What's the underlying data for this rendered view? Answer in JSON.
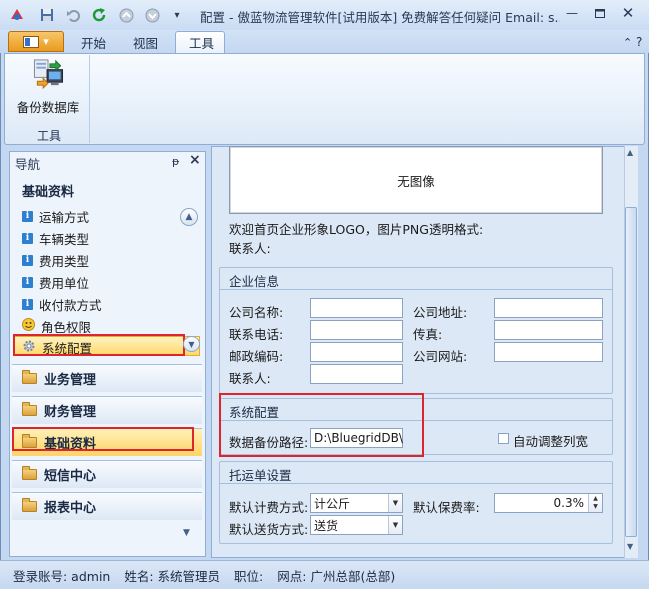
{
  "window": {
    "title": "配置 - 傲蓝物流管理软件[试用版本] 免费解答任何疑问 Email: s..."
  },
  "quick_access": {
    "icons": [
      "save-icon",
      "undo-icon",
      "refresh-icon",
      "up-icon",
      "down-icon"
    ]
  },
  "ribbon": {
    "tabs": [
      {
        "label": "开始"
      },
      {
        "label": "视图"
      },
      {
        "label": "工具"
      }
    ],
    "active_tab": "工具",
    "backup_button": "备份数据库",
    "group_label": "工具"
  },
  "nav": {
    "title": "导航",
    "pin_glyph": "ᵽ",
    "close_glyph": "×",
    "section_title": "基础资料",
    "items": [
      {
        "label": "运输方式"
      },
      {
        "label": "车辆类型"
      },
      {
        "label": "费用类型"
      },
      {
        "label": "费用单位"
      },
      {
        "label": "收付款方式"
      },
      {
        "label": "角色权限"
      },
      {
        "label": "系统配置"
      }
    ],
    "selected_item": "系统配置",
    "groups": [
      {
        "label": "业务管理"
      },
      {
        "label": "财务管理"
      },
      {
        "label": "基础资料"
      },
      {
        "label": "短信中心"
      },
      {
        "label": "报表中心"
      }
    ],
    "active_group": "基础资料"
  },
  "content": {
    "image_placeholder": "无图像",
    "logo_hint": "欢迎首页企业形象LOGO，图片PNG透明格式:",
    "contact_label_top": "联系人:",
    "company": {
      "title": "企业信息",
      "name_label": "公司名称:",
      "address_label": "公司地址:",
      "phone_label": "联系电话:",
      "fax_label": "传真:",
      "zip_label": "邮政编码:",
      "website_label": "公司网站:",
      "contact_label": "联系人:",
      "name_value": "",
      "address_value": "",
      "phone_value": "",
      "fax_value": "",
      "zip_value": "",
      "website_value": "",
      "contact_value": ""
    },
    "system": {
      "title": "系统配置",
      "backup_path_label": "数据备份路径:",
      "backup_path_value": "D:\\BluegridDB\\",
      "auto_adjust_label": "自动调整列宽",
      "auto_adjust_checked": false
    },
    "consign": {
      "title": "托运单设置",
      "billing_label": "默认计费方式:",
      "billing_value": "计公斤",
      "insurance_label": "默认保费率:",
      "insurance_value": "0.3%",
      "delivery_label": "默认送货方式:",
      "delivery_value": "送货"
    }
  },
  "status_bar": {
    "account": "登录账号: admin",
    "name": "姓名: 系统管理员",
    "position": "职位:",
    "site": "网点: 广州总部(总部)"
  },
  "colors": {
    "highlight_border": "#e0242c",
    "selected_fill": "#ffd86a",
    "frame_blue": "#c4d9f1"
  }
}
